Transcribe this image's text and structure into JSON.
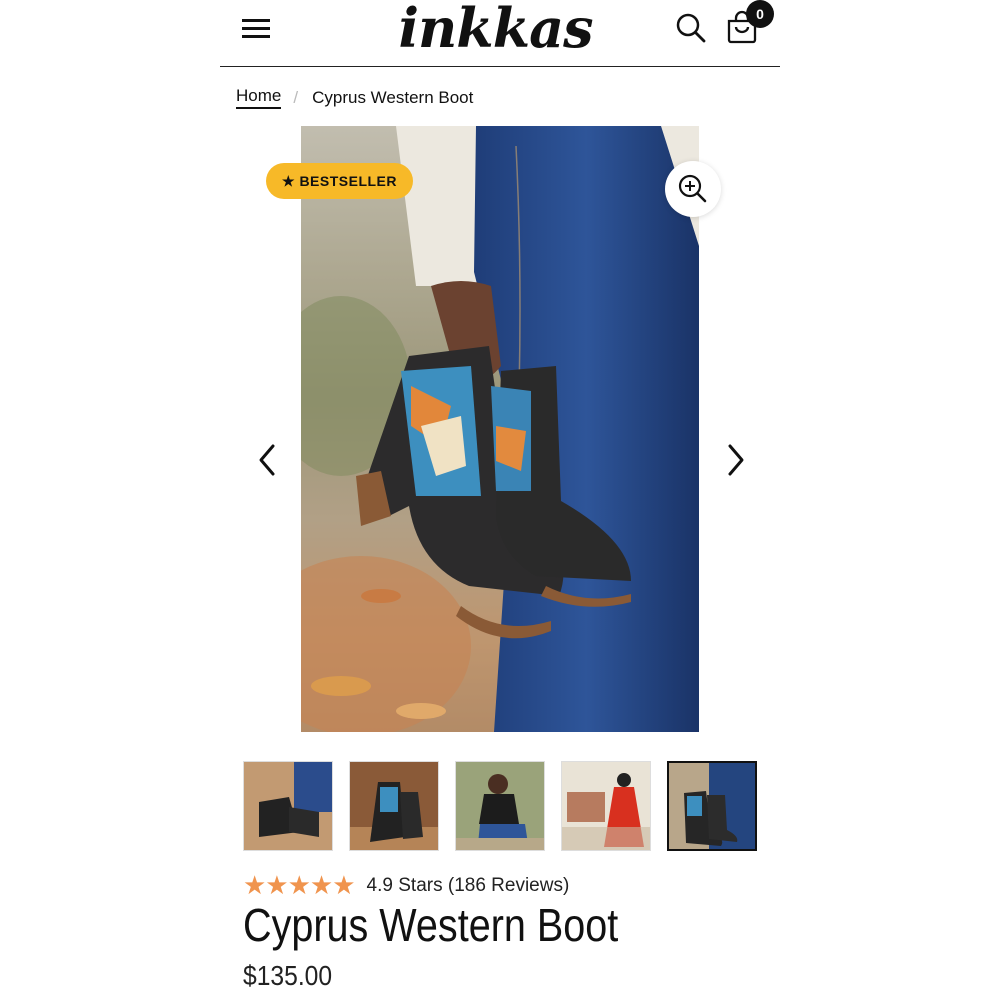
{
  "header": {
    "logo": "inkkas",
    "logo_mark": "®",
    "cart_count": "0"
  },
  "breadcrumb": {
    "home": "Home",
    "separator": "/",
    "current": "Cyprus Western Boot"
  },
  "gallery": {
    "badge": "★ BESTSELLER",
    "thumbnail_count": 5,
    "selected_thumbnail": 5
  },
  "product": {
    "rating_value": 4.9,
    "stars": "★★★★★",
    "rating_text": "4.9 Stars (186 Reviews)",
    "name": "Cyprus Western Boot",
    "price": "$135.00"
  },
  "colors": {
    "badge": "#f7b928",
    "stars": "#f0944e",
    "text": "#111111"
  },
  "icons": [
    "menu-icon",
    "search-icon",
    "bag-icon",
    "zoom-in-icon",
    "chevron-left-icon",
    "chevron-right-icon",
    "star-icon"
  ]
}
